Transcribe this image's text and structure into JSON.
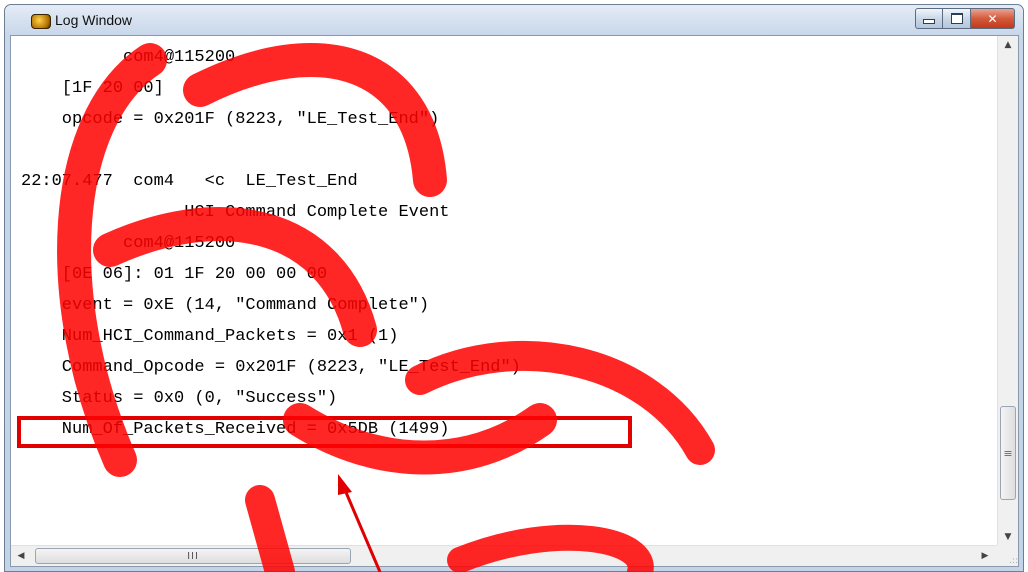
{
  "window": {
    "title": "Log Window",
    "icon": "app-log-icon",
    "buttons": {
      "minimize": "minimize-icon",
      "maximize": "maximize-icon",
      "close": "close-icon"
    }
  },
  "log": {
    "lines": [
      "          com4@115200",
      "    [1F 20 00]",
      "    opcode = 0x201F (8223, \"LE_Test_End\")",
      "",
      "22:07.477  com4   <c  LE_Test_End",
      "                HCI Command Complete Event",
      "          com4@115200",
      "    [0E 06]: 01 1F 20 00 00 00",
      "    event = 0xE (14, \"Command Complete\")",
      "    Num_HCI_Command_Packets = 0x1 (1)",
      "    Command_Opcode = 0x201F (8223, \"LE_Test_End\")",
      "    Status = 0x0 (0, \"Success\")",
      "    Num_Of_Packets_Received = 0x5DB (1499)"
    ]
  },
  "scrollbars": {
    "up_glyph": "▲",
    "down_glyph": "▼",
    "left_glyph": "◀",
    "right_glyph": "▶",
    "v_thumb_grip": "≡",
    "h_thumb_grip": "III",
    "grip": ".::"
  },
  "colors": {
    "highlight": "#e00000",
    "watermark": "#ff0000"
  }
}
